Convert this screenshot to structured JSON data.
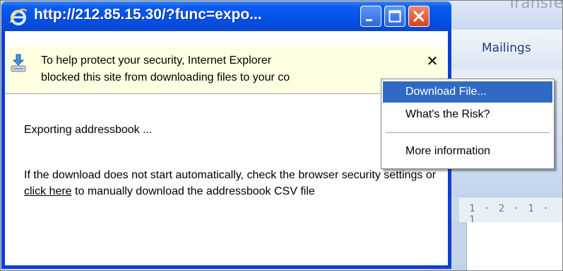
{
  "background_app": {
    "title_partial": "Transfe",
    "tab_mailings": "Mailings",
    "ruler_text": "1 · 2 · 1 · 1"
  },
  "popup": {
    "title": "http://212.85.15.30/?func=expo...",
    "buttons": {
      "minimize": "minimize-icon",
      "maximize": "maximize-icon",
      "close": "close-icon"
    }
  },
  "infobar": {
    "text": "To help protect your security, Internet Explorer\nblocked this site from downloading files to your co",
    "close_glyph": "✕"
  },
  "page": {
    "export_text": "Exporting addressbook ...",
    "help_before": "If the download does not start automatically, check the browser security settings or ",
    "help_link": "click here",
    "help_after": " to manually download the addressbook CSV file"
  },
  "context_menu": {
    "items": [
      {
        "label": "Download File..."
      },
      {
        "label": "What's the Risk?"
      },
      {
        "label": "More information"
      }
    ],
    "selected_index": 0
  },
  "colors": {
    "titlebar_blue": "#0550e6",
    "infobar_yellow": "#ffffe1",
    "menu_highlight": "#316ac5",
    "close_button_red": "#d3421d"
  }
}
